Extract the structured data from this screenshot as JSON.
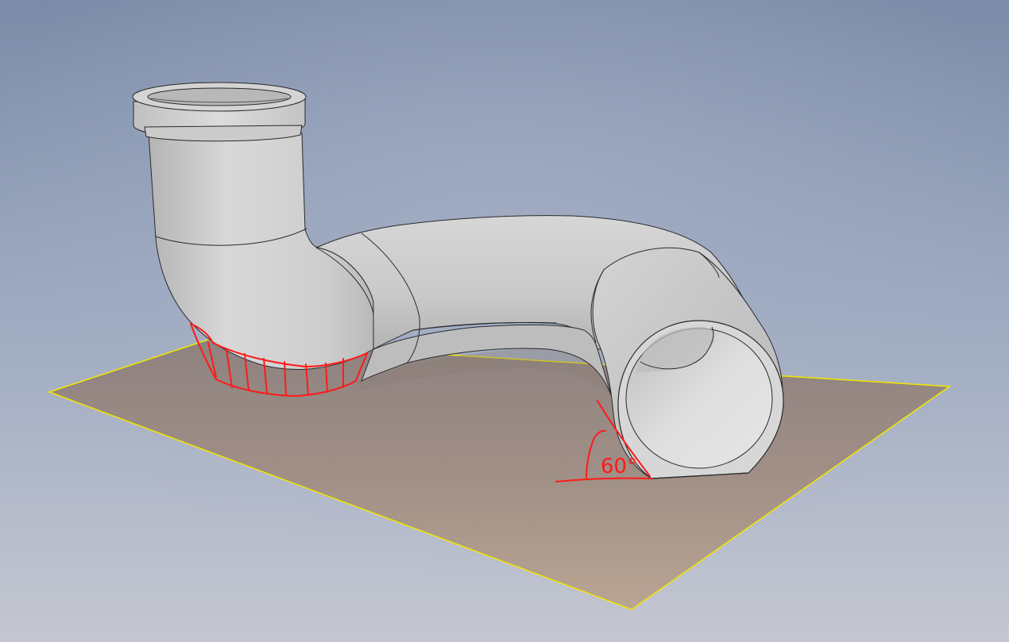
{
  "annotation": {
    "angle_label": "60°"
  },
  "colors": {
    "background_top": "#7b8aa6",
    "background_bottom": "#c5c8d2",
    "ground_plane": "#a89283",
    "plane_edge": "#f2e600",
    "pipe_body": "#cfcfcf",
    "pipe_shadow": "#a8a8a8",
    "pipe_inner": "#dcdcdc",
    "edge_line": "#2a2a2a",
    "markup": "#ff1a1a"
  }
}
